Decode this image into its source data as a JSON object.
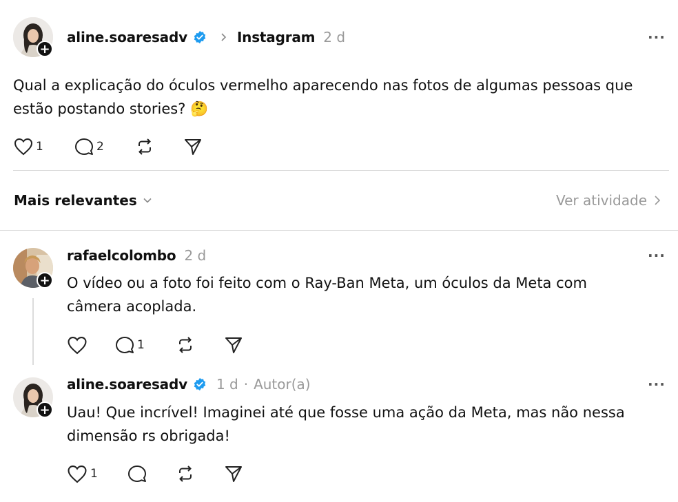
{
  "post": {
    "username": "aline.soaresadv",
    "source": "Instagram",
    "time": "2 d",
    "text": "Qual a explicação do óculos vermelho aparecendo nas fotos de algumas pessoas que estão postando stories? 🤔",
    "likes": "1",
    "replies": "2",
    "more_label": "···"
  },
  "sort": {
    "label": "Mais relevantes",
    "activity": "Ver atividade"
  },
  "replies": [
    {
      "username": "rafaelcolombo",
      "time": "2 d",
      "text": "O vídeo ou a foto foi feito com o Ray-Ban Meta, um óculos da Meta com câmera acoplada.",
      "replies": "1",
      "more_label": "···"
    },
    {
      "username": "aline.soaresadv",
      "time": "1 d",
      "author_tag": "Autor(a)",
      "separator": "·",
      "text": "Uau! Que incrível! Imaginei até que fosse uma ação da Meta, mas não nessa dimensão rs obrigada!",
      "likes": "1",
      "more_label": "···"
    }
  ],
  "icons": {
    "verified": "verified-badge-icon",
    "chevron_right": "chevron-right-icon",
    "chevron_down": "chevron-down-icon",
    "like": "heart-icon",
    "reply": "comment-icon",
    "repost": "repost-icon",
    "share": "send-icon",
    "follow": "plus-icon"
  },
  "colors": {
    "verified": "#1d9bf0",
    "muted": "#999999"
  }
}
